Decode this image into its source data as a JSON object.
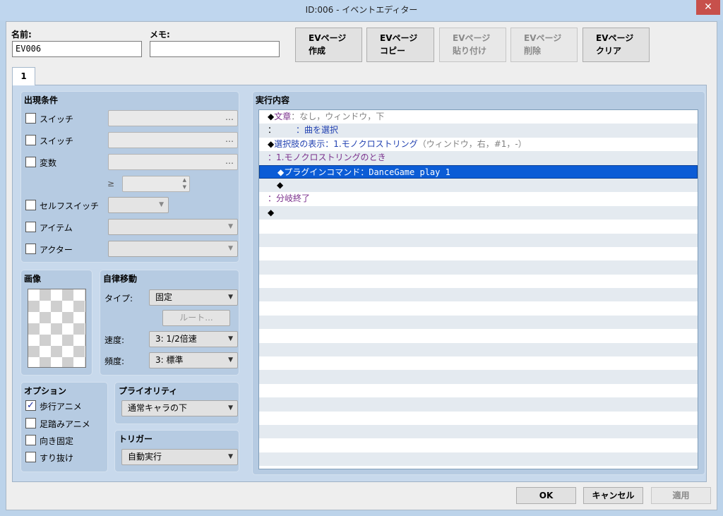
{
  "window": {
    "title": "ID:006 - イベントエディター",
    "close": "✕"
  },
  "header": {
    "name_label": "名前:",
    "name_value": "EV006",
    "memo_label": "メモ:",
    "memo_value": "",
    "buttons": {
      "create": [
        "EVページ",
        "作成"
      ],
      "copy": [
        "EVページ",
        "コピー"
      ],
      "paste": [
        "EVページ",
        "貼り付け"
      ],
      "delete": [
        "EVページ",
        "削除"
      ],
      "clear": [
        "EVページ",
        "クリア"
      ]
    }
  },
  "tabs": [
    "1"
  ],
  "conditions": {
    "title": "出現条件",
    "switch1": "スイッチ",
    "switch2": "スイッチ",
    "variable": "変数",
    "geq": "≥",
    "self_switch": "セルフスイッチ",
    "item": "アイテム",
    "actor": "アクター",
    "ellipsis": "…"
  },
  "image": {
    "title": "画像"
  },
  "autonomous": {
    "title": "自律移動",
    "type_label": "タイプ:",
    "type_value": "固定",
    "route_button": "ルート...",
    "speed_label": "速度:",
    "speed_value": "3: 1/2倍速",
    "freq_label": "頻度:",
    "freq_value": "3: 標準"
  },
  "options": {
    "title": "オプション",
    "walking": "歩行アニメ",
    "walking_checked": "✓",
    "stepping": "足踏みアニメ",
    "direction_fix": "向き固定",
    "through": "すり抜け"
  },
  "priority": {
    "title": "プライオリティ",
    "value": "通常キャラの下"
  },
  "trigger": {
    "title": "トリガー",
    "value": "自動実行"
  },
  "contents": {
    "title": "実行内容",
    "lines": {
      "l1a": "◆",
      "l1b": "文章",
      "l1c": "：なし，ウィンドウ，下",
      "l2a": "：",
      "l2b": "：曲を選択",
      "l3a": "◆",
      "l3b": "選択肢の表示：1.モノクロストリング",
      "l3c": "（ウィンドウ，右，#1，-）",
      "l4": "：1.モノクロストリングのとき",
      "l5a": "◆プラグインコマンド：",
      "l5b": "DanceGame play 1",
      "l6": "◆",
      "l7": "：分岐終了",
      "l8": "◆"
    }
  },
  "footer": {
    "ok": "OK",
    "cancel": "キャンセル",
    "apply": "適用"
  }
}
